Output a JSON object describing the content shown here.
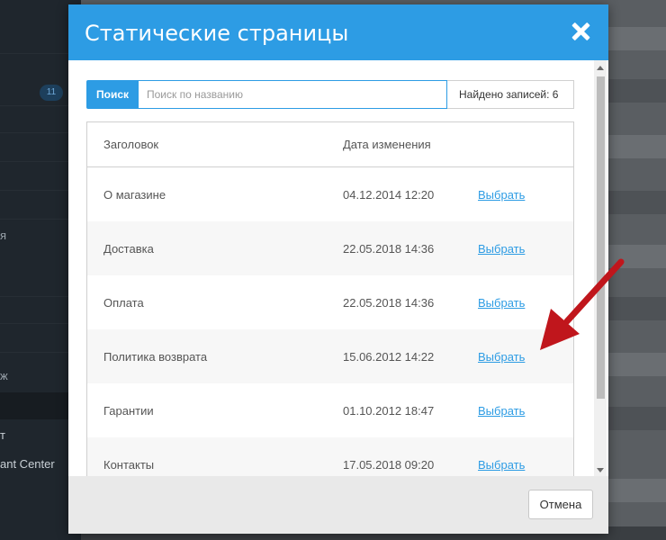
{
  "background": {
    "sidebar_badge": "11",
    "sidebar_fragments": [
      "я",
      "ж",
      "т",
      "ant Center"
    ]
  },
  "modal": {
    "title": "Статические страницы",
    "close_icon": "close-icon",
    "search": {
      "button_label": "Поиск",
      "placeholder": "Поиск по названию",
      "value": "",
      "found_label": "Найдено записей: 6"
    },
    "table": {
      "columns": [
        "Заголовок",
        "Дата изменения",
        ""
      ],
      "rows": [
        {
          "title": "О магазине",
          "date": "04.12.2014 12:20",
          "action": "Выбрать"
        },
        {
          "title": "Доставка",
          "date": "22.05.2018 14:36",
          "action": "Выбрать"
        },
        {
          "title": "Оплата",
          "date": "22.05.2018 14:36",
          "action": "Выбрать"
        },
        {
          "title": "Политика возврата",
          "date": "15.06.2012 14:22",
          "action": "Выбрать"
        },
        {
          "title": "Гарантии",
          "date": "01.10.2012 18:47",
          "action": "Выбрать"
        },
        {
          "title": "Контакты",
          "date": "17.05.2018 09:20",
          "action": "Выбрать"
        }
      ]
    },
    "footer": {
      "cancel_label": "Отмена"
    }
  },
  "colors": {
    "accent": "#2d9ce4",
    "arrow": "#c0161c"
  }
}
